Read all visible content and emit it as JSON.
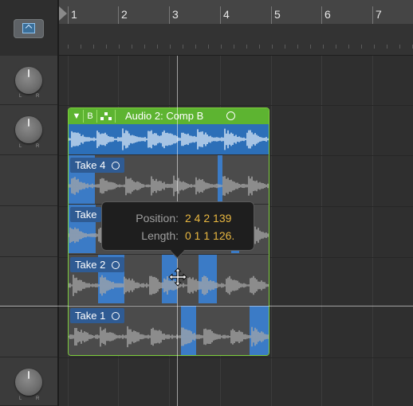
{
  "ruler": {
    "bars": [
      "1",
      "2",
      "3",
      "4",
      "5",
      "6",
      "7"
    ]
  },
  "comp": {
    "title": "Audio 2: Comp B",
    "flag_letter": "B"
  },
  "takes": [
    {
      "label": "Take 4"
    },
    {
      "label": "Take"
    },
    {
      "label": "Take 2"
    },
    {
      "label": "Take 1"
    }
  ],
  "tooltip": {
    "position_label": "Position:",
    "position_value": "2 4 2 139",
    "length_label": "Length:",
    "length_value": "0 1 1 126."
  },
  "knobs": {
    "left": "L",
    "right": "R"
  },
  "colors": {
    "comp_header": "#5db431",
    "comp_border": "#7ecf3c",
    "selection": "#3b7bc6",
    "tooltip_value": "#e7b640"
  },
  "icons": [
    "show-track-headers-icon",
    "pan-knob-icon",
    "disclosure-triangle-icon",
    "flex-icon",
    "take-loop-icon",
    "move-cursor-icon"
  ]
}
